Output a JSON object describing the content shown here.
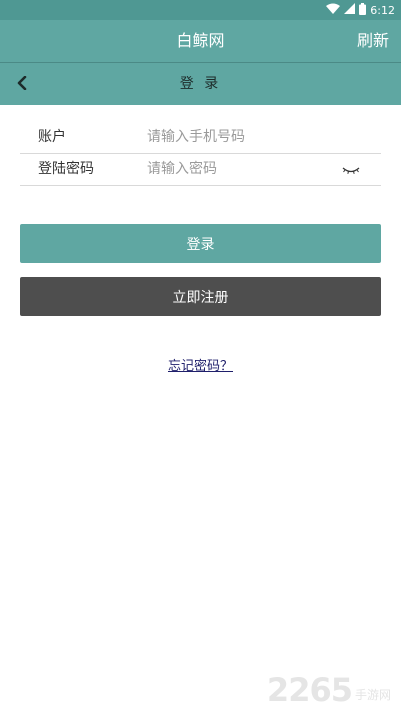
{
  "status_bar": {
    "time": "6:12"
  },
  "app_bar": {
    "title": "白鲸网",
    "refresh_label": "刷新"
  },
  "nav_bar": {
    "title": "登 录"
  },
  "form": {
    "account_label": "账户",
    "account_placeholder": "请输入手机号码",
    "password_label": "登陆密码",
    "password_placeholder": "请输入密码"
  },
  "buttons": {
    "login_label": "登录",
    "register_label": "立即注册"
  },
  "forgot_password_label": "忘记密码？",
  "watermark": {
    "number": "2265",
    "text": "手游网"
  },
  "icons": {
    "wifi": "wifi-icon",
    "signal": "signal-icon",
    "battery": "battery-icon",
    "back": "chevron-left-icon",
    "eye": "eye-closed-icon"
  },
  "colors": {
    "primary": "#5fa7a2",
    "status_bar": "#4f9893",
    "register_button": "#4e4e4e",
    "link": "#1f1f6b"
  }
}
